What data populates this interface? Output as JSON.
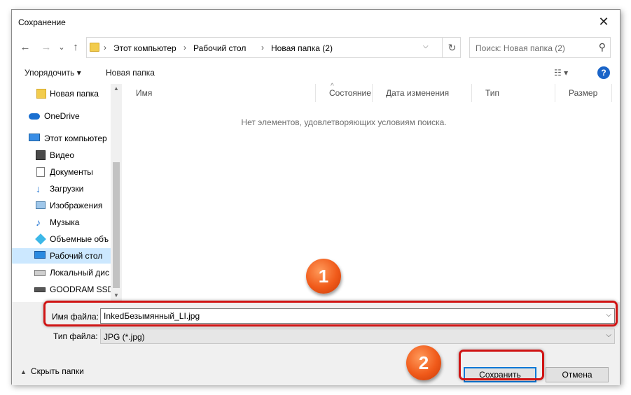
{
  "window": {
    "title": "Сохранение"
  },
  "nav": {
    "back": "←",
    "forward": "→",
    "recent": "⌄",
    "up": "↑"
  },
  "breadcrumb": [
    "Этот компьютер",
    "Рабочий стол",
    "Новая папка (2)"
  ],
  "search": {
    "placeholder": "Поиск: Новая папка (2)"
  },
  "toolbar": {
    "organize": "Упорядочить ▾",
    "new_folder": "Новая папка"
  },
  "sidebar": {
    "items": [
      {
        "label": "Новая папка",
        "icon": "folder-icon"
      },
      {
        "label": "OneDrive",
        "icon": "cloud-icon"
      },
      {
        "label": "Этот компьютер",
        "icon": "computer-icon"
      },
      {
        "label": "Видео",
        "icon": "video-icon"
      },
      {
        "label": "Документы",
        "icon": "document-icon"
      },
      {
        "label": "Загрузки",
        "icon": "download-icon"
      },
      {
        "label": "Изображения",
        "icon": "image-icon"
      },
      {
        "label": "Музыка",
        "icon": "music-icon"
      },
      {
        "label": "Объемные объ",
        "icon": "cube-icon"
      },
      {
        "label": "Рабочий стол",
        "icon": "desktop-icon",
        "selected": true
      },
      {
        "label": "Локальный дис",
        "icon": "drive-icon"
      },
      {
        "label": "GOODRAM SSD",
        "icon": "ssd-icon"
      }
    ]
  },
  "columns": [
    "Имя",
    "Состояние",
    "Дата изменения",
    "Тип",
    "Размер"
  ],
  "empty_message": "Нет элементов, удовлетворяющих условиям поиска.",
  "form": {
    "filename_label": "Имя файла:",
    "filename_value": "InkedБезымянный_LI.jpg",
    "filetype_label": "Тип файла:",
    "filetype_value": "JPG (*.jpg)"
  },
  "footer": {
    "hide_folders": "Скрыть папки",
    "save": "Сохранить",
    "cancel": "Отмена"
  },
  "annotations": {
    "step1": "1",
    "step2": "2"
  },
  "colors": {
    "highlight": "#d01414",
    "badge": "#f05a1a",
    "accent": "#0078d7",
    "selected": "#cce8ff"
  }
}
